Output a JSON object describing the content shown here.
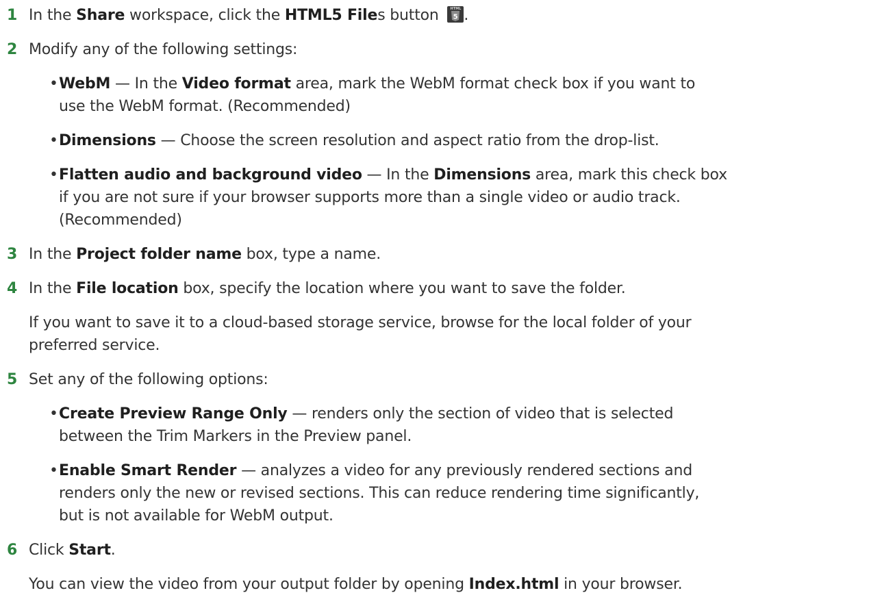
{
  "steps": [
    {
      "num": "1",
      "a": "In the ",
      "b1": "Share",
      "c": " workspace, click the ",
      "b2": "HTML5 File",
      "d": "s button ",
      "e": ".",
      "icon_name": "html5-files-icon",
      "icon_label": "HTML",
      "icon_glyph": "5"
    },
    {
      "num": "2",
      "text": "Modify any of the following settings:",
      "bullets": [
        {
          "bold": "WebM",
          "a": " — In the ",
          "b2": "Video format",
          "c": " area, mark the WebM format check box if you want to",
          "line2": "use the WebM format. (Recommended)"
        },
        {
          "bold": "Dimensions",
          "a": " — Choose the screen resolution and aspect ratio from the drop-list."
        },
        {
          "bold": "Flatten audio and background video",
          "a": " — In the ",
          "b2": "Dimensions",
          "c": " area, mark this check box",
          "line2": "if you are not sure if your browser supports more than a single video or audio track.",
          "line3": "(Recommended)"
        }
      ]
    },
    {
      "num": "3",
      "a": "In the ",
      "b1": "Project folder name",
      "c": " box, type a name."
    },
    {
      "num": "4",
      "a": "In the ",
      "b1": "File location",
      "c": " box, specify the location where you want to save the folder.",
      "para1": "If you want to save it to a cloud-based storage service, browse for the local folder of your",
      "para2": "preferred service."
    },
    {
      "num": "5",
      "text": "Set any of the following options:",
      "bullets": [
        {
          "bold": "Create Preview Range Only",
          "a": " — renders only the section of video that is selected",
          "line2": "between the Trim Markers in the Preview panel."
        },
        {
          "bold": "Enable Smart Render",
          "a": " — analyzes a video for any previously rendered sections and",
          "line2": "renders only the new or revised sections. This can reduce rendering time significantly,",
          "line3": "but is not available for WebM output."
        }
      ]
    },
    {
      "num": "6",
      "a": "Click ",
      "b1": "Start",
      "c": ".",
      "para1a": "You can view the video from your output folder by opening ",
      "para1b": "Index.html",
      "para1c": " in your browser."
    }
  ],
  "colors": {
    "step_number": "#2e8540",
    "body_text": "#333333"
  }
}
